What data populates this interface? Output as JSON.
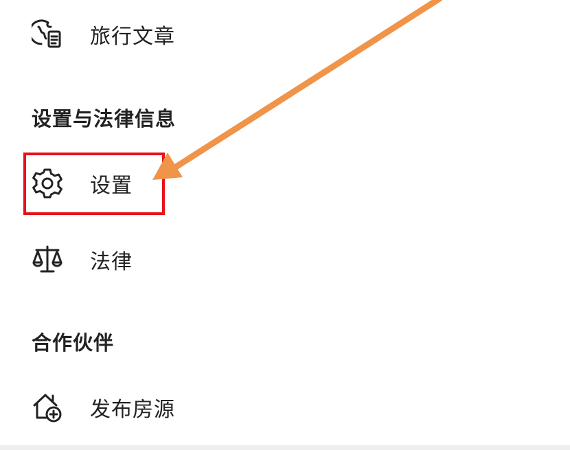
{
  "menu": {
    "travel_articles": {
      "label": "旅行文章",
      "icon": "globe-document-icon"
    },
    "settings_legal_header": "设置与法律信息",
    "settings": {
      "label": "设置",
      "icon": "gear-icon"
    },
    "legal": {
      "label": "法律",
      "icon": "scales-icon"
    },
    "partners_header": "合作伙伴",
    "list_property": {
      "label": "发布房源",
      "icon": "house-plus-icon"
    }
  },
  "annotations": {
    "highlight_color": "#e8101a",
    "arrow_color": "#f0944a"
  }
}
